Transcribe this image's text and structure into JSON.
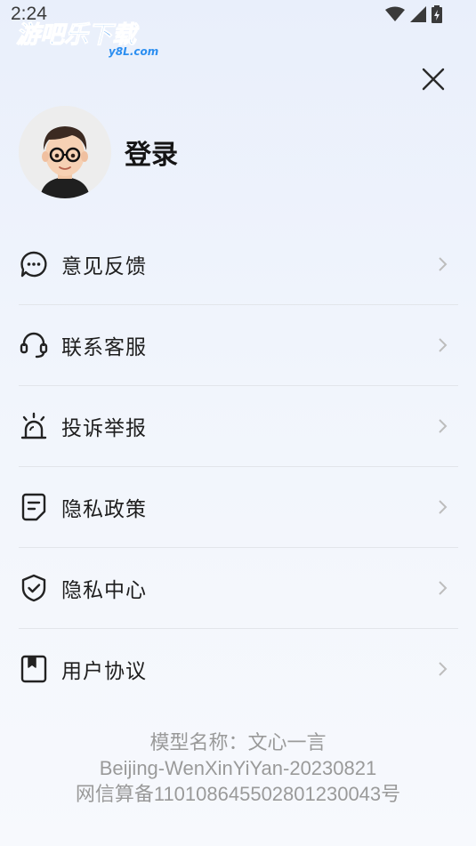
{
  "status_bar": {
    "time": "2:24"
  },
  "watermark": {
    "text": "游吧乐下载",
    "domain": "y8L.com"
  },
  "profile": {
    "login_label": "登录"
  },
  "menu": [
    {
      "label": "意见反馈",
      "icon": "feedback-chat-icon"
    },
    {
      "label": "联系客服",
      "icon": "headset-icon"
    },
    {
      "label": "投诉举报",
      "icon": "alarm-icon"
    },
    {
      "label": "隐私政策",
      "icon": "document-icon"
    },
    {
      "label": "隐私中心",
      "icon": "shield-check-icon"
    },
    {
      "label": "用户协议",
      "icon": "bookmark-book-icon"
    }
  ],
  "footer": {
    "model_name": "模型名称：文心一言",
    "model_id": "Beijing-WenXinYiYan-20230821",
    "filing": "网信算备110108645502801230043号"
  }
}
